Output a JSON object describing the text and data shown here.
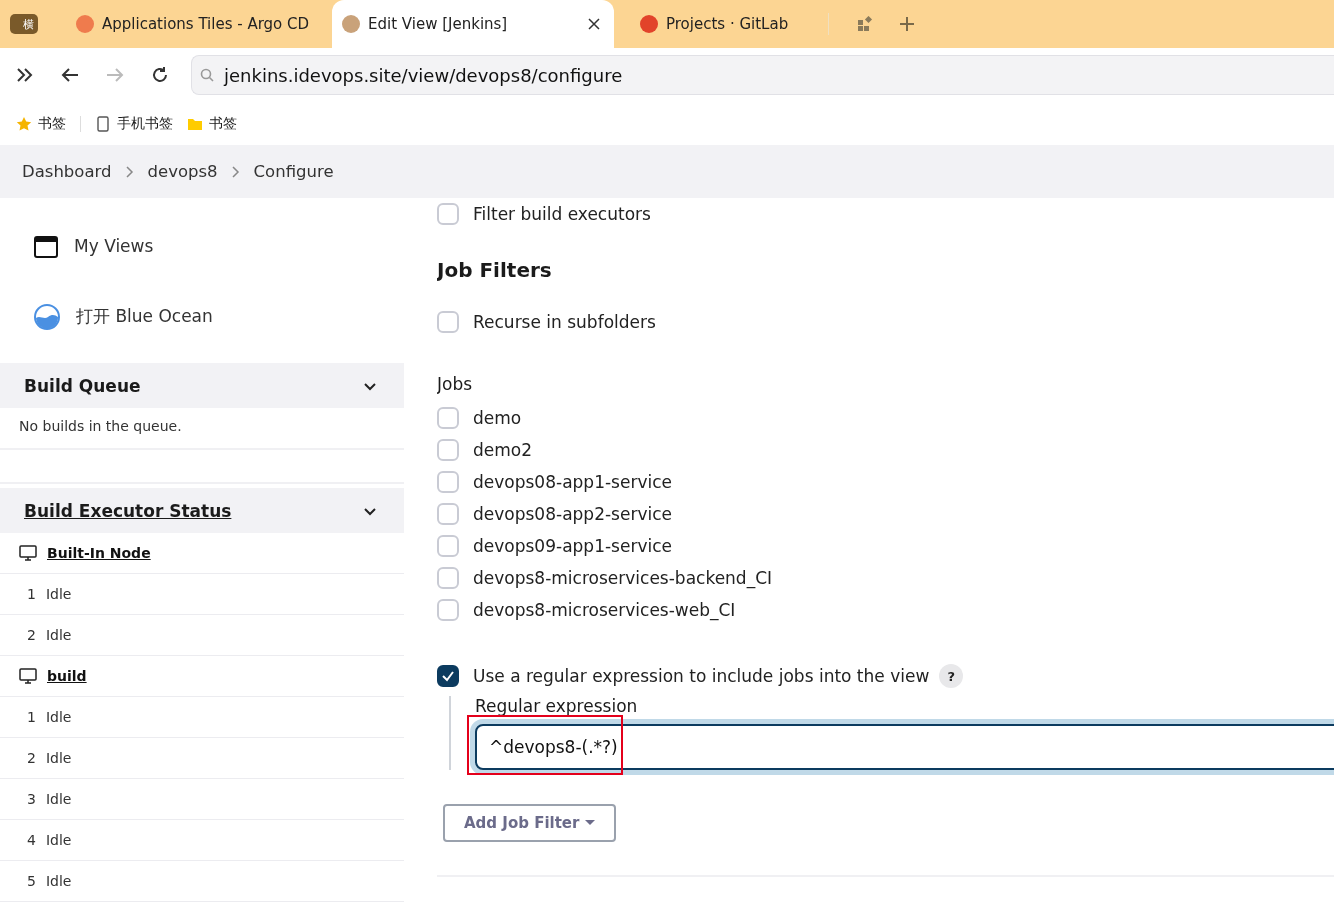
{
  "browser": {
    "side_badge": "横",
    "tabs": [
      {
        "title": "Applications Tiles - Argo CD",
        "selected": false,
        "color": "#ef7b4d"
      },
      {
        "title": "Edit View [Jenkins]",
        "selected": true,
        "color": "#c9a27a"
      },
      {
        "title": "Projects · GitLab",
        "selected": false,
        "color": "#e2432a"
      }
    ],
    "address": "jenkins.idevops.site/view/devops8/configure",
    "bookmarks": [
      {
        "label": "书签",
        "kind": "star"
      },
      {
        "label": "手机书签",
        "kind": "phone"
      },
      {
        "label": "书签",
        "kind": "folder"
      }
    ]
  },
  "breadcrumb": [
    "Dashboard",
    "devops8",
    "Configure"
  ],
  "sidebar": {
    "tasks": [
      {
        "label": "My Views",
        "kind": "window"
      },
      {
        "label": "打开 Blue Ocean",
        "kind": "ocean"
      }
    ],
    "build_queue": {
      "title": "Build Queue",
      "expanded": true,
      "message": "No builds in the queue."
    },
    "executor_status": {
      "title": "Build Executor Status",
      "expanded": true,
      "nodes": [
        {
          "name": "Built-In Node",
          "executors": [
            {
              "number": "1",
              "status": "Idle"
            },
            {
              "number": "2",
              "status": "Idle"
            }
          ]
        },
        {
          "name": "build",
          "executors": [
            {
              "number": "1",
              "status": "Idle"
            },
            {
              "number": "2",
              "status": "Idle"
            },
            {
              "number": "3",
              "status": "Idle"
            },
            {
              "number": "4",
              "status": "Idle"
            },
            {
              "number": "5",
              "status": "Idle"
            }
          ]
        }
      ]
    }
  },
  "form": {
    "filter_executors": {
      "label": "Filter build executors",
      "checked": false
    },
    "section_title": "Job Filters",
    "recurse": {
      "label": "Recurse in subfolders",
      "checked": false
    },
    "jobs_label": "Jobs",
    "jobs": [
      {
        "name": "demo",
        "checked": false
      },
      {
        "name": "demo2",
        "checked": false
      },
      {
        "name": "devops08-app1-service",
        "checked": false
      },
      {
        "name": "devops08-app2-service",
        "checked": false
      },
      {
        "name": "devops09-app1-service",
        "checked": false
      },
      {
        "name": "devops8-microservices-backend_CI",
        "checked": false
      },
      {
        "name": "devops8-microservices-web_CI",
        "checked": false
      }
    ],
    "regex": {
      "label": "Use a regular expression to include jobs into the view",
      "checked": true,
      "help": "?"
    },
    "regex_field": {
      "label": "Regular expression",
      "value": "^devops8-(.*?)",
      "highlighted": true
    },
    "add_button": "Add Job Filter"
  }
}
